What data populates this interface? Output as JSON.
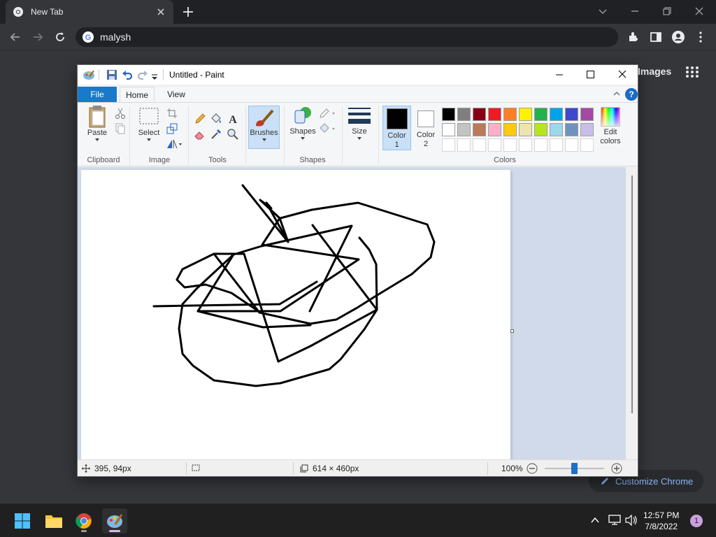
{
  "chrome": {
    "tab_title": "New Tab",
    "address": "malysh",
    "ntp_images_label": "Images",
    "customize_label": "Customize Chrome"
  },
  "paint": {
    "window_title": "Untitled - Paint",
    "menu": {
      "file": "File",
      "home": "Home",
      "view": "View",
      "help": "?"
    },
    "ribbon": {
      "paste": "Paste",
      "select": "Select",
      "brushes": "Brushes",
      "shapes_btn": "Shapes",
      "size": "Size",
      "color1": "Color",
      "color1_num": "1",
      "color2": "Color",
      "color2_num": "2",
      "edit_colors_1": "Edit",
      "edit_colors_2": "colors",
      "groups": {
        "clipboard": "Clipboard",
        "image": "Image",
        "tools": "Tools",
        "shapes": "Shapes",
        "colors": "Colors"
      },
      "palette_row1": [
        "#000000",
        "#7f7f7f",
        "#880015",
        "#ed1c24",
        "#ff7f27",
        "#fff200",
        "#22b14c",
        "#00a2e8",
        "#3f48cc",
        "#a349a4"
      ],
      "palette_row2": [
        "#ffffff",
        "#c3c3c3",
        "#b97a57",
        "#ffaec9",
        "#ffc90e",
        "#efe4b0",
        "#b5e61d",
        "#99d9ea",
        "#7092be",
        "#c8bfe7"
      ]
    },
    "status": {
      "cursor_pos": "395, 94px",
      "canvas_size": "614 × 460px",
      "zoom": "100%"
    }
  },
  "taskbar": {
    "time": "12:57 PM",
    "date": "7/8/2022",
    "notifications": "1"
  }
}
